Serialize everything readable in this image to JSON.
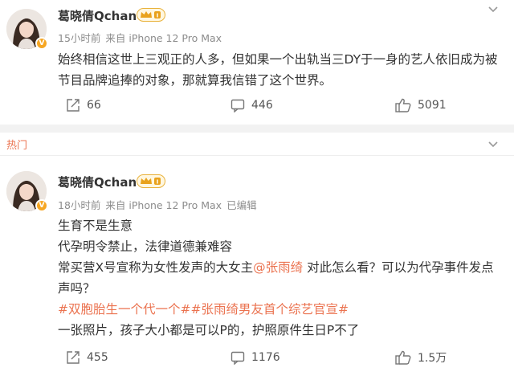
{
  "colors": {
    "accent": "#eb7350",
    "muted": "#8c8c8c",
    "text": "#333333",
    "badge": "#f6a623"
  },
  "post1": {
    "author": "葛晓倩Qchan",
    "time": "15小时前",
    "source": "来自 iPhone 12 Pro Max",
    "content_lines": [
      "始终相信这世上三观正的人多，但如果一个出轨当三DY于一身的艺人依旧成为被",
      "节目品牌追捧的对象，那就算我信错了这个世界。"
    ],
    "reposts": "66",
    "comments": "446",
    "likes": "5091"
  },
  "section_label": "热门",
  "post2": {
    "author": "葛晓倩Qchan",
    "time": "18小时前",
    "source": "来自 iPhone 12 Pro Max",
    "edited": "已编辑",
    "line1": "生育不是生意",
    "line2": "代孕明令禁止，法律道德兼难容",
    "line3_pre": "常买营X号宣称为女性发声的大女主",
    "mention": "@张雨绮",
    "line3_post": " 对此怎么看？可以为代孕事件发点",
    "line4": "声吗？",
    "tags": "#双胞胎生一个代一个##张雨绮男友首个综艺官宣#",
    "line6": "一张照片，孩子大小都是可以P的，护照原件生日P不了",
    "reposts": "455",
    "comments": "1176",
    "likes": "1.5万"
  },
  "icons": [
    "avatar",
    "verified-badge",
    "crown-badge-icon",
    "chevron-down-icon",
    "repost-icon",
    "comment-icon",
    "like-icon"
  ]
}
